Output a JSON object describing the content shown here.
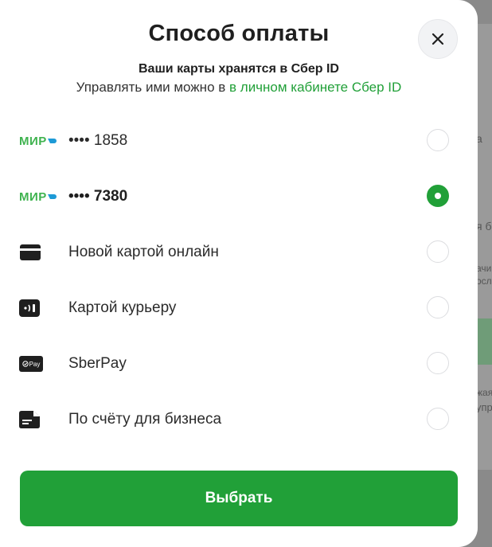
{
  "background": {
    "fragments": [
      "а",
      "я б",
      "ачи",
      "осл",
      "жая",
      "упра"
    ]
  },
  "modal": {
    "title": "Способ оплаты",
    "subtitle": "Ваши карты хранятся в Сбер ID",
    "manage_prefix": "Управлять ими можно в ",
    "manage_link": "в личном кабинете Сбер ID",
    "options": [
      {
        "icon": "mir-logo",
        "logo_text": "МИР",
        "label": "•••• 1858",
        "selected": false
      },
      {
        "icon": "mir-logo",
        "logo_text": "МИР",
        "label": "•••• 7380",
        "selected": true
      },
      {
        "icon": "card-icon",
        "label": "Новой картой онлайн",
        "selected": false
      },
      {
        "icon": "card-terminal-icon",
        "label": "Картой курьеру",
        "selected": false
      },
      {
        "icon": "sberpay-icon",
        "logo_text": "Pay",
        "label": "SberPay",
        "selected": false
      },
      {
        "icon": "invoice-icon",
        "label": "По счёту для бизнеса",
        "selected": false
      }
    ],
    "submit_label": "Выбрать"
  },
  "colors": {
    "accent": "#21a038",
    "mir": "#3fb34f",
    "mir_blue": "#1d9ad6"
  }
}
